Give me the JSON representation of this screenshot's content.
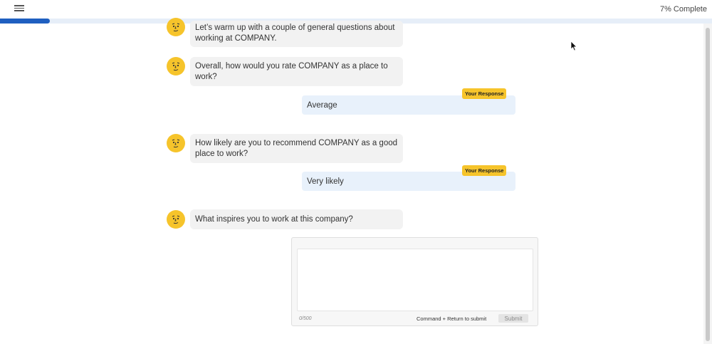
{
  "header": {
    "menu_icon": "hamburger-menu-icon",
    "progress_text": "7% Complete",
    "progress": 0.07
  },
  "messages": [
    {
      "type": "bot",
      "text": "Let’s warm up with a couple of general questions about working at COMPANY."
    },
    {
      "type": "bot",
      "text": "Overall, how would you rate COMPANY as a place to work?"
    },
    {
      "type": "user",
      "badge": "Your Response",
      "text": "Average"
    },
    {
      "type": "bot",
      "text": "How likely are you to recommend COMPANY as a good place to work?"
    },
    {
      "type": "user",
      "badge": "Your Response",
      "text": "Very likely"
    },
    {
      "type": "bot",
      "text": "What inspires you to work at this company?"
    }
  ],
  "answer": {
    "value": "",
    "counter": "0/500",
    "hint": "Command + Return to submit",
    "submit_label": "Submit"
  },
  "colors": {
    "accent": "#1f5fc0",
    "avatar": "#f6c42b",
    "badge": "#f6c42b",
    "user_bubble": "#e8f1fb",
    "bot_bubble": "#f2f2f2"
  }
}
